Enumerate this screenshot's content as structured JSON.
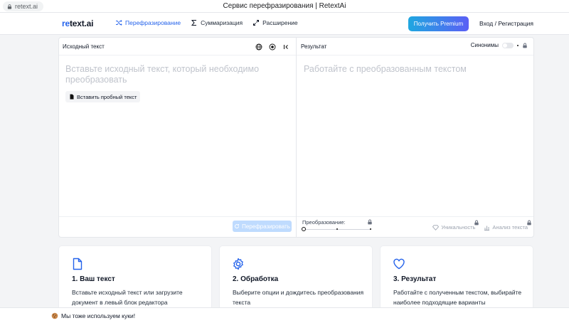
{
  "browser": {
    "url": "retext.ai",
    "tab_title": "Сервис перефразирования | RetextAi"
  },
  "header": {
    "logo_accent": "re",
    "logo_rest": "text.ai",
    "nav": [
      {
        "label": "Перефразирование",
        "icon": "shuffle-icon",
        "active": true
      },
      {
        "label": "Суммаризация",
        "icon": "sigma-icon",
        "active": false
      },
      {
        "label": "Расширение",
        "icon": "expand-icon",
        "active": false
      }
    ],
    "premium_label": "Получить Premium",
    "login_label": "Вход / Регистрация"
  },
  "editor": {
    "source": {
      "title": "Исходный текст",
      "placeholder": "Вставьте исходный текст, который необходимо преобразовать",
      "sample_label": "Вставить пробный текст",
      "paraphrase_label": "Перефразировать"
    },
    "result": {
      "title": "Результат",
      "synonyms_label": "Синонимы",
      "placeholder": "Работайте с преобразованным текстом",
      "conversion_label": "Преобразование:",
      "uniqueness_label": "Уникальность",
      "analysis_label": "Анализ текста"
    }
  },
  "cards": [
    {
      "title": "1. Ваш текст",
      "desc": "Вставьте исходный текст или загрузите документ в левый блок редактора",
      "icon": "document-icon"
    },
    {
      "title": "2. Обработка",
      "desc": "Выберите опции и дождитесь преобразования текста",
      "icon": "gear-icon"
    },
    {
      "title": "3. Результат",
      "desc": "Работайте с полученным текстом, выбирайте наиболее подходящие варианты",
      "icon": "heart-icon"
    }
  ],
  "cookie": {
    "text": "Мы тоже используем куки!",
    "icon": "cookie-icon"
  },
  "colors": {
    "accent": "#2563eb",
    "premium_start": "#1fa7e0",
    "premium_end": "#5b5ff5",
    "button_disabled": "#bfdbfe"
  }
}
